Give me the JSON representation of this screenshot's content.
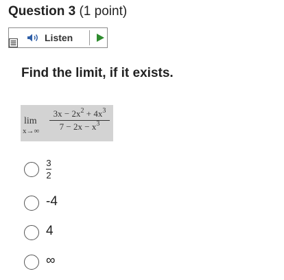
{
  "question": {
    "title": "Question 3",
    "points": "(1 point)"
  },
  "toolbar": {
    "listen_label": "Listen",
    "icons": [
      "menu-icon",
      "speaker-icon",
      "play-icon"
    ],
    "play_color": "#2e8b2e"
  },
  "prompt": "Find the limit, if it exists.",
  "math": {
    "lim": "lim",
    "lim_sub": "x→∞",
    "numerator": {
      "a": "3x − 2x",
      "a_exp": "2",
      "b": " + 4x",
      "b_exp": "3"
    },
    "denominator": {
      "a": "7 − 2x − x",
      "a_exp": "3"
    },
    "background": "#d3d3d3"
  },
  "options": [
    {
      "numerator": "3",
      "denominator": "2"
    },
    {
      "label": "-4"
    },
    {
      "label": "4"
    },
    {
      "label": "∞"
    }
  ]
}
